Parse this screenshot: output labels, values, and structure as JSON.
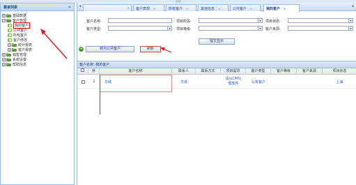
{
  "sidebar": {
    "title": "菜单列表",
    "collapse_glyph": "«",
    "tree": [
      {
        "label": "基础数据",
        "level": 0,
        "type": "folder",
        "expander": "+"
      },
      {
        "label": "客户管理",
        "level": 0,
        "type": "folder",
        "expander": "−"
      },
      {
        "label": "我的客户",
        "level": 1,
        "type": "leaf",
        "selected": true
      },
      {
        "label": "公共客户",
        "level": 1,
        "type": "leaf"
      },
      {
        "label": "所有客户",
        "level": 1,
        "type": "leaf"
      },
      {
        "label": "客户修改",
        "level": 1,
        "type": "leaf"
      },
      {
        "label": "统计报表",
        "level": 0,
        "type": "folder",
        "expander": "+"
      },
      {
        "label": "客户报表",
        "level": 0,
        "type": "folder",
        "expander": "+"
      },
      {
        "label": "销售管理",
        "level": 0,
        "type": "folder",
        "expander": "+"
      },
      {
        "label": "系统设置",
        "level": 0,
        "type": "folder",
        "expander": "+"
      },
      {
        "label": "帮助信息",
        "level": 0,
        "type": "folder",
        "expander": "+"
      }
    ]
  },
  "tabs": [
    {
      "label": "",
      "active": false
    },
    {
      "label": "客户表现",
      "active": false
    },
    {
      "label": "所有客户",
      "active": false
    },
    {
      "label": "其他信息",
      "active": false
    },
    {
      "label": "公共客户",
      "active": false
    },
    {
      "label": "我的客户",
      "active": true
    }
  ],
  "tab_close_glyph": "×",
  "tab_scroll_left": "◂",
  "tab_scroll_right": "▸",
  "search_form": {
    "customer_name_label": "客户名称:",
    "project_stage_label": "项目阶段:",
    "project_status_label": "项目状态:",
    "customer_type_label": "客户类型:",
    "project_level_label": "项目等级:",
    "customer_source_label": "客户来源:",
    "submit_button": "提交显示",
    "transfer_button": "转为公共客户",
    "refresh_button": "刷新"
  },
  "grid": {
    "title": "客户名称: 我的客户",
    "columns": [
      "",
      "序",
      "客户名称",
      "联系人",
      "联系方式",
      "项目需求",
      "客户类型",
      "客户等级",
      "客户来源",
      "项目状态"
    ],
    "rows": [
      {
        "checked": false,
        "index": "1",
        "customer_name": "华城",
        "contact": "华城",
        "contact_method": "",
        "project_demand_line1": "请(LCMS)",
        "project_demand_line2": "理软件",
        "customer_type": "公有客户",
        "customer_level": "",
        "customer_source": "",
        "project_status": "上海"
      }
    ]
  },
  "colors": {
    "panel_border": "#99bbe8",
    "header_text": "#15428b",
    "annotation_red": "#d4202a",
    "link_blue": "#1e58c8"
  }
}
